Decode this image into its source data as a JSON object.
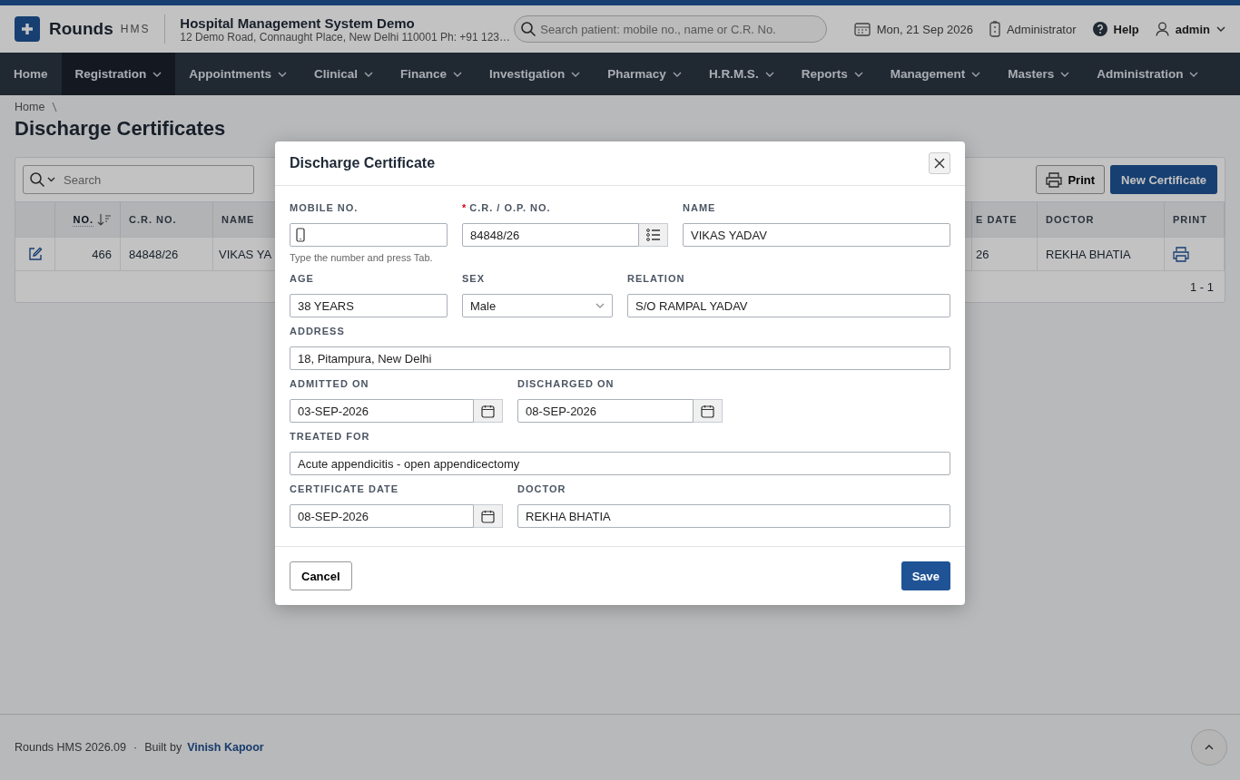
{
  "header": {
    "logo": {
      "name": "Rounds",
      "suffix": "HMS"
    },
    "org": {
      "title": "Hospital Management System Demo",
      "address": "12 Demo Road, Connaught Place, New Delhi 110001 Ph: +91 123…"
    },
    "search": {
      "placeholder": "Search patient: mobile no., name or C.R. No."
    },
    "date": "Mon, 21 Sep 2026",
    "role": "Administrator",
    "help": "Help",
    "user": "admin"
  },
  "nav": [
    {
      "label": "Home",
      "selected": false,
      "has_menu": false
    },
    {
      "label": "Registration",
      "selected": true,
      "has_menu": true
    },
    {
      "label": "Appointments",
      "selected": false,
      "has_menu": true
    },
    {
      "label": "Clinical",
      "selected": false,
      "has_menu": true
    },
    {
      "label": "Finance",
      "selected": false,
      "has_menu": true
    },
    {
      "label": "Investigation",
      "selected": false,
      "has_menu": true
    },
    {
      "label": "Pharmacy",
      "selected": false,
      "has_menu": true
    },
    {
      "label": "H.R.M.S.",
      "selected": false,
      "has_menu": true
    },
    {
      "label": "Reports",
      "selected": false,
      "has_menu": true
    },
    {
      "label": "Management",
      "selected": false,
      "has_menu": true
    },
    {
      "label": "Masters",
      "selected": false,
      "has_menu": true
    },
    {
      "label": "Administration",
      "selected": false,
      "has_menu": true
    }
  ],
  "breadcrumb": [
    "Home"
  ],
  "page_title": "Discharge Certificates",
  "toolbar": {
    "search": {
      "placeholder": "Search"
    },
    "print": "Print",
    "new": "New Certificate"
  },
  "table": {
    "columns": [
      {
        "label": "NO.",
        "sorted": true
      },
      {
        "label": "C.R. NO.",
        "sorted": false
      },
      {
        "label": "NAME",
        "sorted": false
      },
      {
        "label": "E DATE",
        "sorted": false
      },
      {
        "label": "DOCTOR",
        "sorted": false
      },
      {
        "label": "PRINT",
        "sorted": false
      }
    ],
    "rows": [
      {
        "cells": [
          "466",
          "84848/26",
          "VIKAS YA",
          "26",
          "REKHA BHATIA"
        ]
      }
    ],
    "pager": "1 - 1"
  },
  "modal": {
    "title": "Discharge Certificate",
    "rows": [
      [
        {
          "kind": "phone",
          "label": "MOBILE NO.",
          "hint": "Type the number and press Tab."
        },
        {
          "kind": "lookup",
          "label": "C.R. / O.P. NO.",
          "required_marker": "*",
          "value": "84848/26"
        },
        {
          "kind": "text",
          "label": "NAME",
          "value": "VIKAS YADAV"
        }
      ],
      [
        {
          "kind": "text",
          "label": "AGE",
          "value": "38 YEARS"
        },
        {
          "kind": "select",
          "label": "SEX",
          "value": "Male"
        },
        {
          "kind": "text",
          "label": "RELATION",
          "value": "S/O RAMPAL YADAV"
        }
      ],
      [
        {
          "kind": "text",
          "label": "ADDRESS",
          "value": "18, Pitampura, New Delhi"
        }
      ],
      [
        {
          "kind": "date",
          "label": "ADMITTED ON",
          "value": "03-SEP-2026"
        },
        {
          "kind": "date",
          "label": "DISCHARGED ON",
          "value": "08-SEP-2026"
        }
      ],
      [
        {
          "kind": "text",
          "label": "TREATED FOR",
          "value": "Acute appendicitis - open appendicectomy"
        }
      ],
      [
        {
          "kind": "date",
          "label": "CERTIFICATE DATE",
          "value": "08-SEP-2026"
        },
        {
          "kind": "text",
          "label": "DOCTOR",
          "value": "REKHA BHATIA"
        }
      ]
    ],
    "cancel": "Cancel",
    "save": "Save"
  },
  "footer": {
    "version": "Rounds HMS 2026.09",
    "separator": "·",
    "built_by": "Built by",
    "author": "Vinish Kapoor"
  }
}
